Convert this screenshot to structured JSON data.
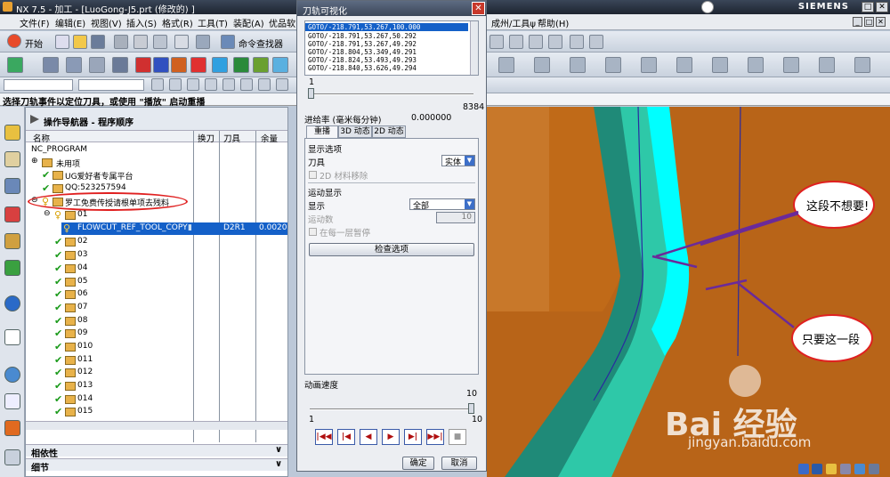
{
  "window": {
    "title": "NX 7.5 - 加工 - [LuoGong-J5.prt (修改的) ]",
    "brand": "SIEMENS"
  },
  "menu": [
    "文件(F)",
    "编辑(E)",
    "视图(V)",
    "插入(S)",
    "格式(R)",
    "工具(T)",
    "装配(A)",
    "优品软",
    "成州/工具ψ",
    "帮助(H)"
  ],
  "toolbar": {
    "start_label": "开始",
    "command_search_label": "命令查找器"
  },
  "status_prompt": "选择刀轨事件以定位刀具，或使用 \"播放\" 启动重播",
  "navigator": {
    "title": "操作导航器 - 程序顺序",
    "columns": {
      "name": "名称",
      "toolchange": "换刀",
      "tool": "刀具",
      "stock": "余量"
    },
    "rows": [
      {
        "label": "NC_PROGRAM"
      },
      {
        "label": "未用项"
      },
      {
        "label": "UG爱好者专属平台"
      },
      {
        "label": "QQ:523257594"
      },
      {
        "label": "罗工免费传授请根单项去残料"
      },
      {
        "label": "01"
      },
      {
        "label": "FLOWCUT_REF_TOOL_COPY",
        "tool": "D2R1",
        "stock": "0.0020"
      },
      {
        "label": "02"
      },
      {
        "label": "03"
      },
      {
        "label": "04"
      },
      {
        "label": "05"
      },
      {
        "label": "06"
      },
      {
        "label": "07"
      },
      {
        "label": "08"
      },
      {
        "label": "09"
      },
      {
        "label": "010"
      },
      {
        "label": "011"
      },
      {
        "label": "012"
      },
      {
        "label": "013"
      },
      {
        "label": "014"
      },
      {
        "label": "015"
      }
    ],
    "panels": {
      "dependencies": "相依性",
      "details": "细节"
    }
  },
  "dialog": {
    "title": "刀轨可视化",
    "goto_lines": [
      "GOTO/-218.791,53.267,100.000",
      "GOTO/-218.791,53.267,50.292",
      "GOTO/-218.791,53.267,49.292",
      "GOTO/-218.804,53.349,49.291",
      "GOTO/-218.824,53.493,49.293",
      "GOTO/-218.840,53.626,49.294"
    ],
    "slider_min": "1",
    "slider_max": "8384",
    "feed_label": "进给率 (毫米每分钟)",
    "feed_value": "0.000000",
    "tabs": [
      "重播",
      "3D 动态",
      "2D 动态"
    ],
    "display_options": "显示选项",
    "tool_label": "刀具",
    "tool_value": "实体",
    "material_remove": "2D 材料移除",
    "motion_display": "运动显示",
    "display_label": "显示",
    "display_value": "全部",
    "motion_count_label": "运动数",
    "motion_count_value": "10",
    "pause_each_layer": "在每一层暂停",
    "check_options": "检查选项",
    "anim_speed_label": "动画速度",
    "speed_min": "1",
    "speed_max": "10",
    "speed_value": "10",
    "ok": "确定",
    "cancel": "取消"
  },
  "annotations": {
    "not_wanted": "这段不想要!",
    "only_this": "只要这一段"
  },
  "watermark": {
    "text": "Bai  经验",
    "url": "jingyan.baidu.com"
  },
  "colors": {
    "stock": "#c06a18",
    "toolpath": "#2ec8a8",
    "highlight": "#00ffff",
    "arrow": "#6a2a9a",
    "annotation_ring": "#e02020"
  }
}
